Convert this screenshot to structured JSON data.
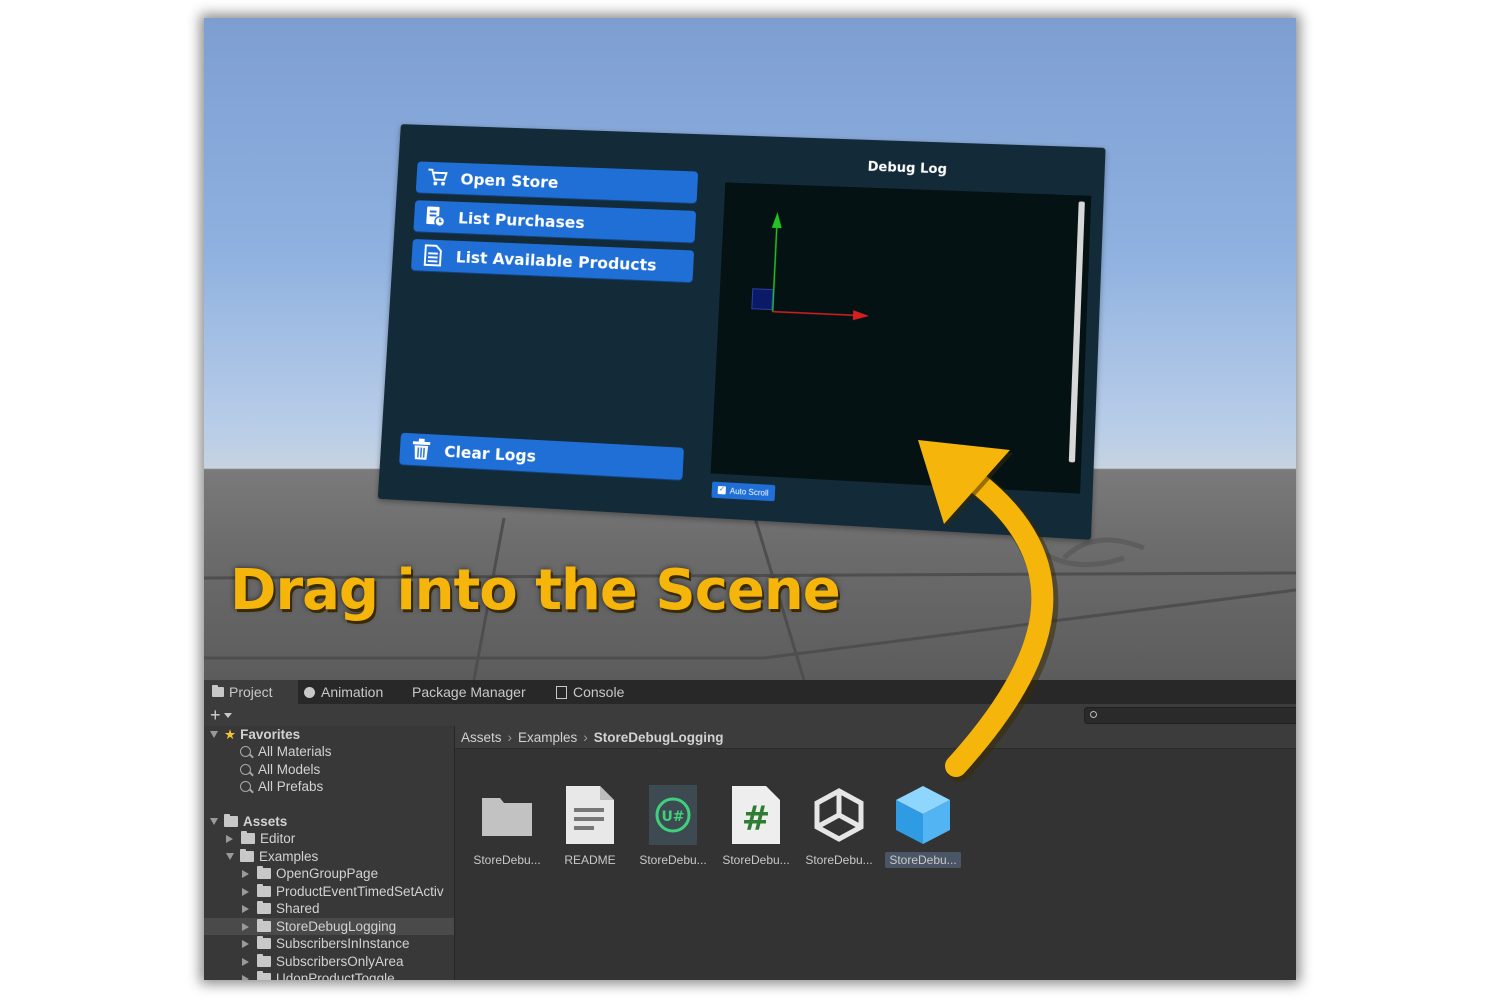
{
  "scene": {
    "headline": "Drag into the Scene",
    "panel": {
      "buttons": [
        {
          "label": "Open Store",
          "icon": "cart-icon"
        },
        {
          "label": "List Purchases",
          "icon": "receipt-clock-icon"
        },
        {
          "label": "List Available Products",
          "icon": "document-icon"
        }
      ],
      "clear_label": "Clear Logs",
      "log_title": "Debug Log",
      "auto_scroll_label": "Auto Scroll"
    },
    "colors": {
      "button": "#1f6fd6",
      "panel": "#132a39",
      "headline": "#f5b50a",
      "arrow": "#f5b50a"
    }
  },
  "project": {
    "tabs": [
      "Project",
      "Animation",
      "Package Manager",
      "Console"
    ],
    "add_label": "+",
    "favorites": {
      "label": "Favorites",
      "items": [
        "All Materials",
        "All Models",
        "All Prefabs"
      ]
    },
    "assets": {
      "label": "Assets",
      "children": [
        {
          "label": "Editor"
        },
        {
          "label": "Examples"
        }
      ],
      "examples_children": [
        "OpenGroupPage",
        "ProductEventTimedSetActiv",
        "Shared",
        "StoreDebugLogging",
        "SubscribersInInstance",
        "SubscribersOnlyArea",
        "UdonProductToggle"
      ],
      "selected": "StoreDebugLogging"
    },
    "breadcrumb": [
      "Assets",
      "Examples",
      "StoreDebugLogging"
    ],
    "files": [
      {
        "label": "StoreDebu...",
        "icon": "folder-icon"
      },
      {
        "label": "README",
        "icon": "text-document-icon"
      },
      {
        "label": "StoreDebu...",
        "icon": "udon-sharp-icon"
      },
      {
        "label": "StoreDebu...",
        "icon": "csharp-script-icon"
      },
      {
        "label": "StoreDebu...",
        "icon": "unity-scene-icon"
      },
      {
        "label": "StoreDebu...",
        "icon": "prefab-cube-icon"
      }
    ],
    "selected_file_index": 5
  }
}
